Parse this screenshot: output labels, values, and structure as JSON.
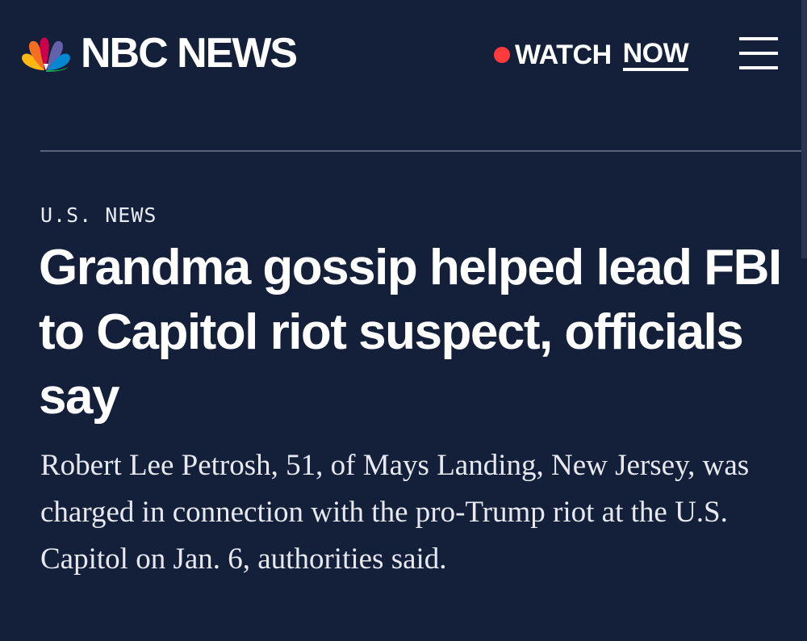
{
  "header": {
    "brand": "NBC NEWS",
    "logo_icon": "nbc-peacock-icon",
    "watch_prefix": "WATCH",
    "watch_suffix": "NOW",
    "live_color": "#ff3b3b",
    "menu_icon": "hamburger-menu-icon"
  },
  "article": {
    "category": "U.S. NEWS",
    "headline": "Grandma gossip helped lead FBI to Capitol riot suspect, officials say",
    "dek": "Robert Lee Petrosh, 51, of Mays Landing, New Jersey, was charged in connection with the pro-Trump riot at the U.S. Capitol on Jan. 6, authorities said."
  },
  "colors": {
    "background": "#14203a",
    "text": "#ffffff",
    "divider": "#5b6479"
  }
}
